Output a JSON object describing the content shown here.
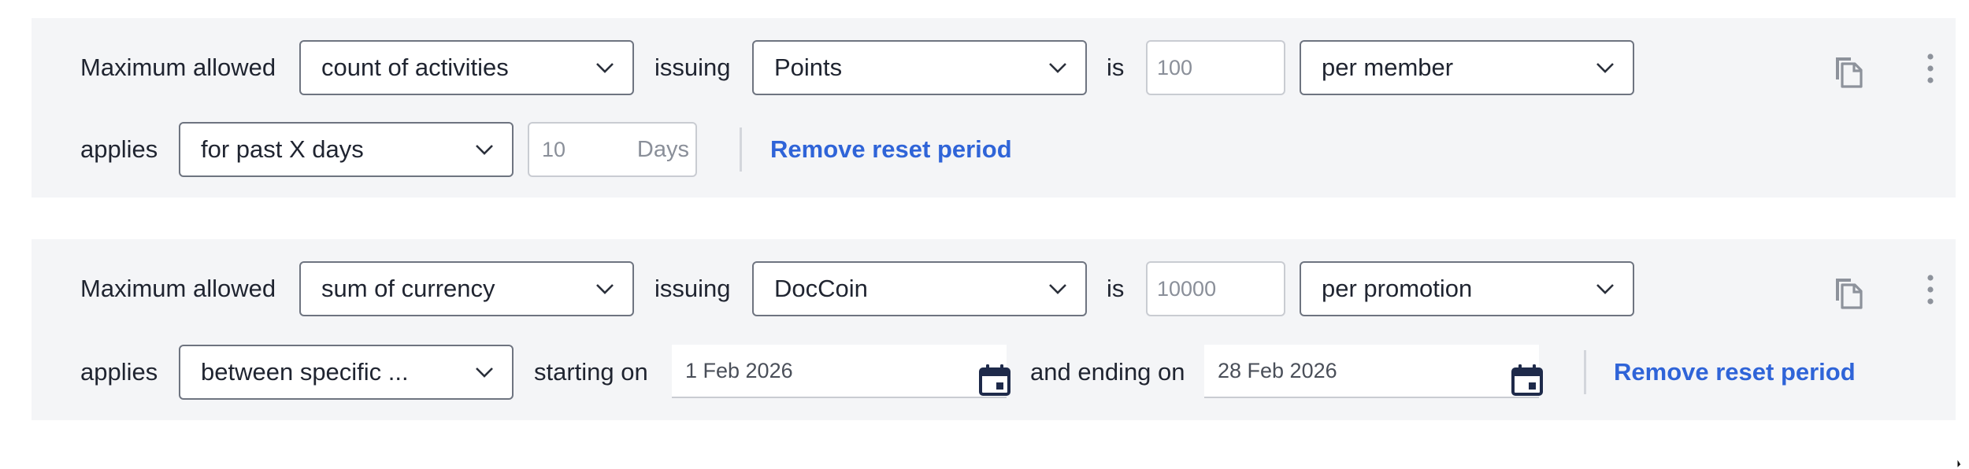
{
  "rules": [
    {
      "label_max": "Maximum allowed",
      "metric": "count of activities",
      "label_issuing": "issuing",
      "reward": "Points",
      "label_is": "is",
      "limit": "100",
      "scope": "per member",
      "label_applies": "applies",
      "period": "for past X days",
      "days_value": "10",
      "days_unit": "Days",
      "remove_label": "Remove reset period"
    },
    {
      "label_max": "Maximum allowed",
      "metric": "sum of currency",
      "label_issuing": "issuing",
      "reward": "DocCoin",
      "label_is": "is",
      "limit": "10000",
      "scope": "per promotion",
      "label_applies": "applies",
      "period": "between specific ...",
      "label_start": "starting on",
      "start_date": "1 Feb 2026",
      "label_end": "and ending on",
      "end_date": "28 Feb 2026",
      "remove_label": "Remove reset period"
    }
  ],
  "icons": {
    "copy": "copy-icon",
    "more": "more-vertical-icon",
    "chevron": "chevron-down-icon",
    "calendar": "calendar-icon"
  },
  "colors": {
    "link": "#2f64d8",
    "panel_bg": "#f4f5f7",
    "border": "#6e7480",
    "calendar": "#1e2a4a"
  }
}
